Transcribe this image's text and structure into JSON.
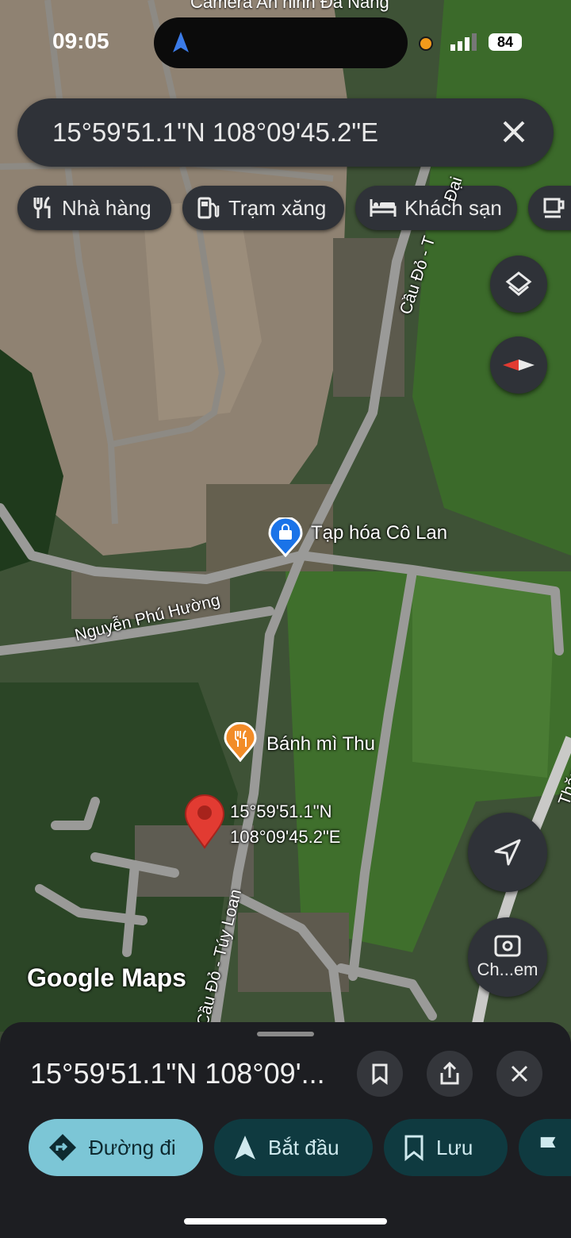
{
  "status": {
    "time": "09:05",
    "battery": "84",
    "top_caption": "Camera An ninh Đà Nẵng"
  },
  "search": {
    "query": "15°59'51.1\"N 108°09'45.2\"E"
  },
  "chips": [
    {
      "label": "Nhà hàng",
      "icon": "fork-knife-icon"
    },
    {
      "label": "Trạm xăng",
      "icon": "gas-pump-icon"
    },
    {
      "label": "Khách sạn",
      "icon": "bed-icon"
    },
    {
      "label": "",
      "icon": "coffee-icon"
    }
  ],
  "map": {
    "places": {
      "grocery": "Tạp hóa Cô Lan",
      "bakery": "Bánh mì Thu",
      "pin_lat": "15°59'51.1\"N",
      "pin_lon": "108°09'45.2\"E"
    },
    "roads": {
      "nguyen_phu_huong": "Nguyễn Phú Hường",
      "cau_do_tuy_loan_bottom": "Cầu Đỏ - Túy Loan",
      "cau_do_top": "Cầu Đỏ - T",
      "dai": "Đại",
      "thang": "Thăng"
    },
    "watermark": "Google Maps",
    "camera_button_label": "Ch...em"
  },
  "sheet": {
    "title": "15°59'51.1\"N 108°09'...",
    "actions": [
      {
        "label": "Đường đi",
        "icon": "directions-icon"
      },
      {
        "label": "Bắt đầu",
        "icon": "navigation-arrow-icon"
      },
      {
        "label": "Lưu",
        "icon": "bookmark-icon"
      },
      {
        "label": "",
        "icon": "flag-icon"
      }
    ]
  },
  "colors": {
    "accent": "#7cc6d6",
    "chip_bg": "#2f3238",
    "sheet_bg": "#1d1e22",
    "pin": "#e23b32"
  }
}
